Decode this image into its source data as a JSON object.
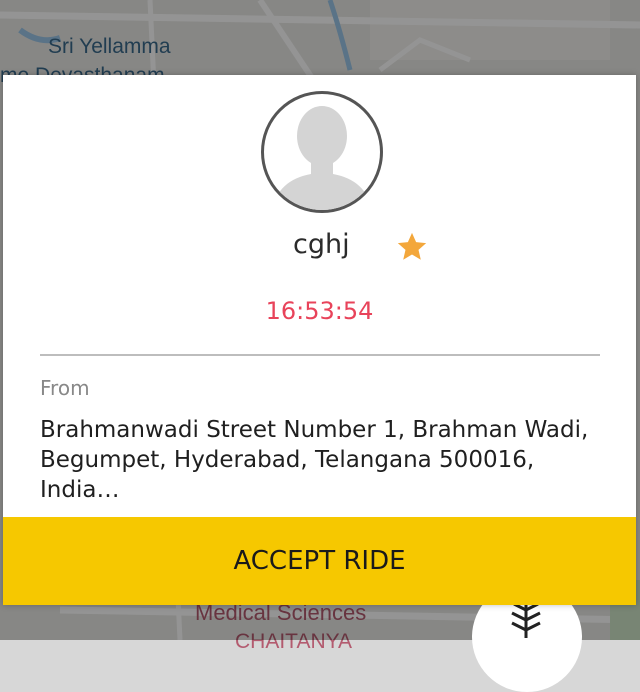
{
  "map": {
    "label_top": "Sri Yellamma",
    "label_second": "me Devasthanam",
    "label_bottom": "Medical Sciences",
    "label_bottom_partial": "CHAITANYA"
  },
  "dialog": {
    "rider_name": "cghj",
    "rating_icon": "star-icon",
    "timer": "16:53:54",
    "from_label": "From",
    "address": "Brahmanwadi Street Number 1, Brahman Wadi, Begumpet, Hyderabad, Telangana 500016, India…",
    "accept_label": "ACCEPT RIDE"
  },
  "colors": {
    "accent_yellow": "#f6c800",
    "timer_red": "#e8435a",
    "star_orange": "#f3a73b"
  }
}
